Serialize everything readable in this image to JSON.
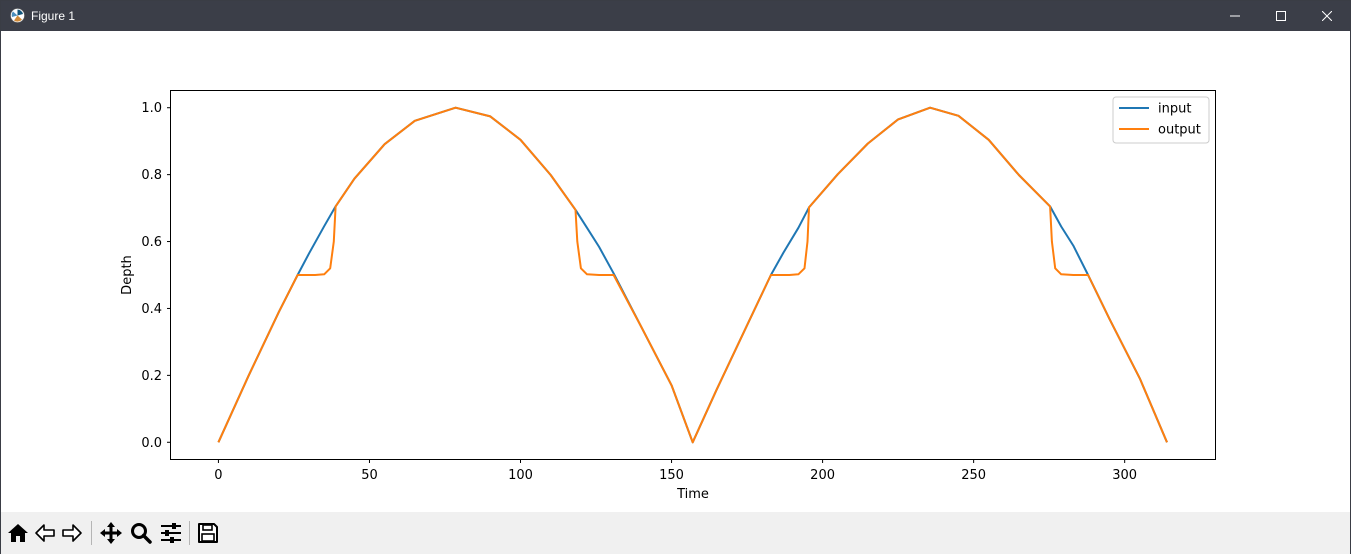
{
  "window": {
    "title": "Figure 1"
  },
  "toolbar": {
    "tools": [
      "home-icon",
      "back-arrow-icon",
      "forward-arrow-icon",
      "pan-icon",
      "zoom-icon",
      "configure-subplots-icon",
      "save-icon"
    ]
  },
  "colors": {
    "titlebar": "#3b3e48",
    "input": "#1f77b4",
    "output": "#ff7f0e",
    "toolbar": "#f0f0f0"
  },
  "chart_data": {
    "type": "line",
    "xlabel": "Time",
    "ylabel": "Depth",
    "xlim": [
      -15.7,
      329.9
    ],
    "ylim": [
      -0.05,
      1.05
    ],
    "xticks": [
      0,
      50,
      100,
      150,
      200,
      250,
      300
    ],
    "yticks": [
      0.0,
      0.2,
      0.4,
      0.6,
      0.8,
      1.0
    ],
    "xtick_labels": [
      "0",
      "50",
      "100",
      "150",
      "200",
      "250",
      "300"
    ],
    "ytick_labels": [
      "0.0",
      "0.2",
      "0.4",
      "0.6",
      "0.8",
      "1.0"
    ],
    "grid": false,
    "legend_position": "top-right",
    "series": [
      {
        "name": "input",
        "color": "#1f77b4",
        "x": [
          0,
          10,
          20,
          26.2,
          30,
          35,
          38.8,
          45,
          55,
          65,
          78.5,
          90,
          100,
          110,
          118.2,
          122,
          126,
          130.8,
          140,
          150,
          157,
          165,
          175,
          182.9,
          187,
          192,
          195.5,
          205,
          215,
          225,
          235.6,
          245,
          255,
          265,
          275.3,
          279,
          283,
          287.9,
          295,
          305,
          314
        ],
        "y": [
          0,
          0.199,
          0.389,
          0.5,
          0.565,
          0.646,
          0.705,
          0.788,
          0.891,
          0.961,
          1.0,
          0.974,
          0.904,
          0.799,
          0.695,
          0.641,
          0.584,
          0.505,
          0.345,
          0.17,
          0.0,
          0.159,
          0.35,
          0.5,
          0.566,
          0.641,
          0.702,
          0.801,
          0.893,
          0.965,
          1.0,
          0.976,
          0.904,
          0.799,
          0.705,
          0.645,
          0.588,
          0.5,
          0.368,
          0.191,
          0.0
        ]
      },
      {
        "name": "output",
        "color": "#ff7f0e",
        "x": [
          0,
          10,
          20,
          26.2,
          28,
          32,
          35,
          37,
          38.2,
          38.8,
          45,
          55,
          65,
          78.5,
          90,
          100,
          110,
          118.2,
          118.8,
          120,
          122,
          126,
          130.8,
          140,
          150,
          157,
          165,
          175,
          182.9,
          185,
          189,
          192,
          194,
          195,
          195.5,
          205,
          215,
          225,
          235.6,
          245,
          255,
          265,
          275.3,
          275.9,
          277,
          279,
          283,
          287.9,
          295,
          305,
          314
        ],
        "y": [
          0,
          0.199,
          0.389,
          0.5,
          0.5,
          0.5,
          0.502,
          0.52,
          0.6,
          0.705,
          0.788,
          0.891,
          0.961,
          1.0,
          0.974,
          0.904,
          0.799,
          0.695,
          0.6,
          0.52,
          0.502,
          0.5,
          0.5,
          0.345,
          0.17,
          0.0,
          0.159,
          0.35,
          0.5,
          0.5,
          0.5,
          0.502,
          0.52,
          0.6,
          0.702,
          0.801,
          0.893,
          0.965,
          1.0,
          0.976,
          0.904,
          0.799,
          0.705,
          0.6,
          0.52,
          0.502,
          0.5,
          0.5,
          0.368,
          0.191,
          0.0
        ]
      }
    ]
  }
}
